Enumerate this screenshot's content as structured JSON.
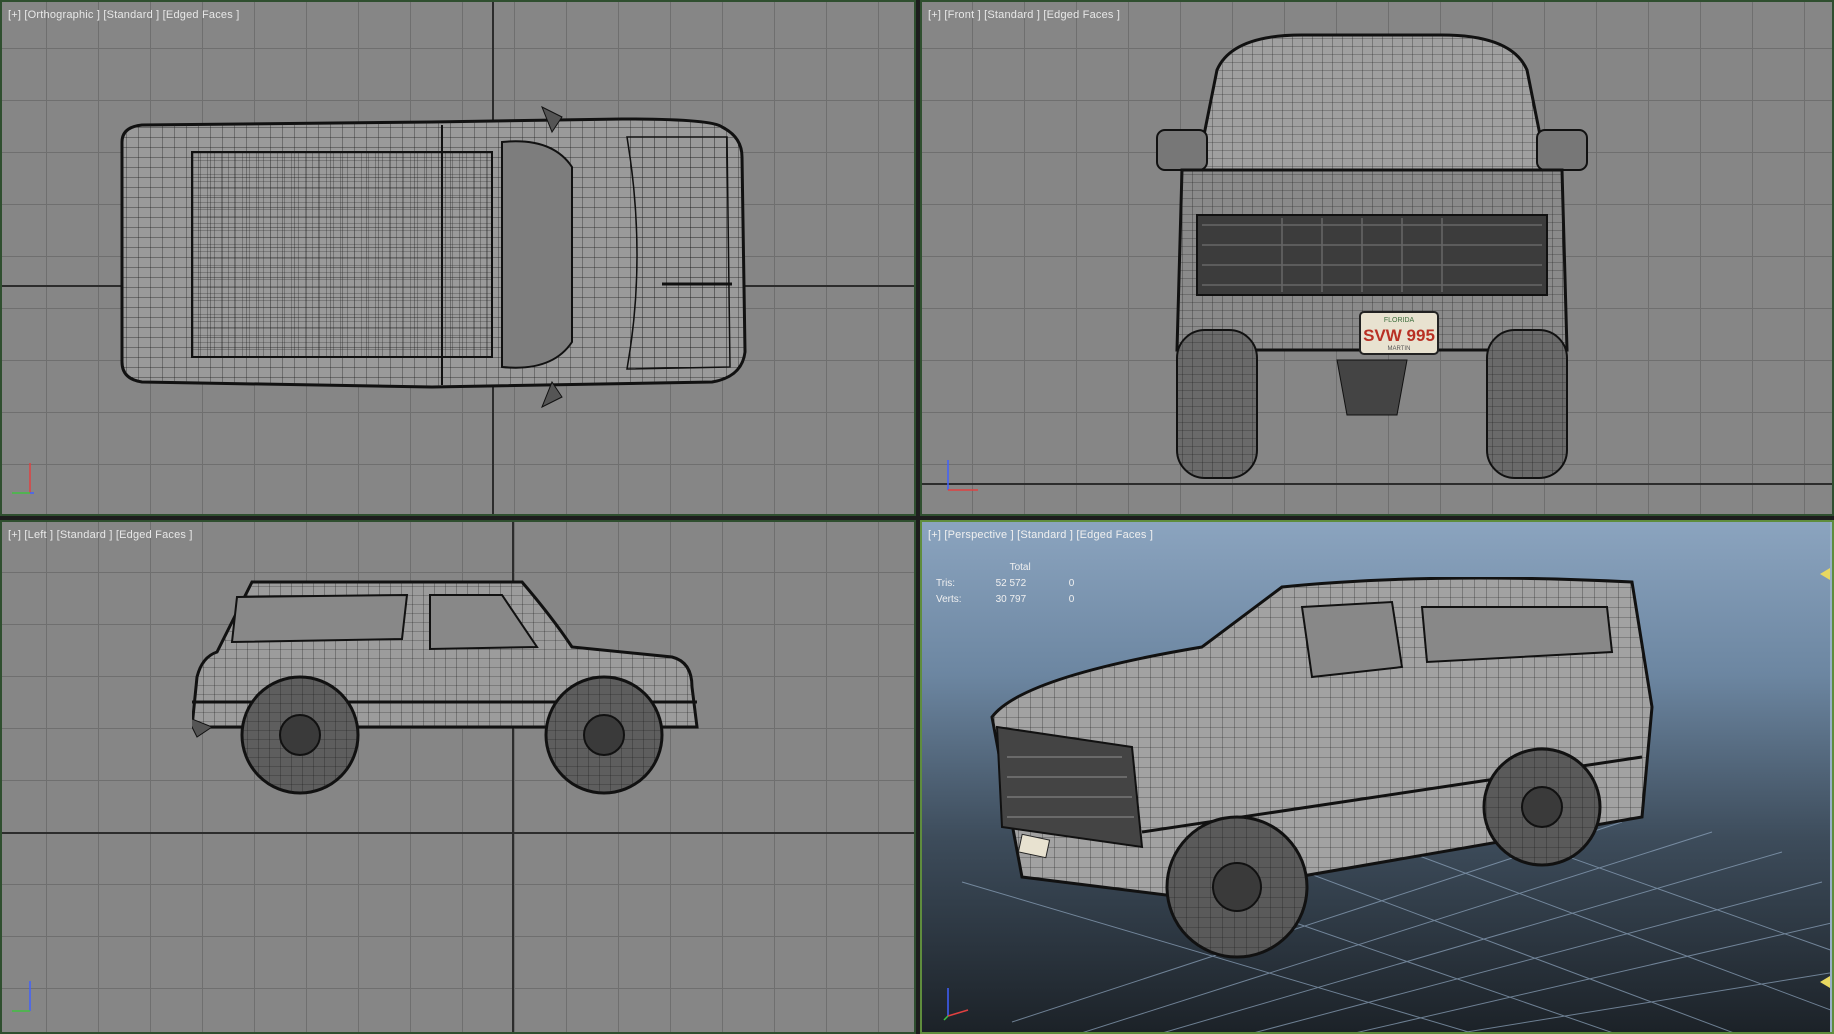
{
  "viewports": {
    "top": {
      "label": "[+] [Orthographic ] [Standard ] [Edged Faces ]"
    },
    "front": {
      "label": "[+] [Front ] [Standard ] [Edged Faces ]"
    },
    "left": {
      "label": "[+] [Left ] [Standard ] [Edged Faces ]"
    },
    "persp": {
      "label": "[+] [Perspective ] [Standard ] [Edged Faces ]"
    }
  },
  "stats": {
    "header": "Total",
    "rows": [
      {
        "label": "Tris:",
        "value": "52 572",
        "sel": "0"
      },
      {
        "label": "Verts:",
        "value": "30 797",
        "sel": "0"
      }
    ]
  },
  "license_plate": {
    "text": "SVW 995",
    "state": "FLORIDA",
    "county": "MARTIN"
  },
  "colors": {
    "viewport_border": "#2f4f2f",
    "active_border": "#5f8d3d",
    "ortho_bg": "#868686",
    "axis_x": "#e04040",
    "axis_y": "#40c040",
    "axis_z": "#4060ff"
  },
  "icons": {
    "axis_gizmo": "axis-tripod-icon",
    "viewport_scroll_marker": "triangle-marker-icon"
  }
}
